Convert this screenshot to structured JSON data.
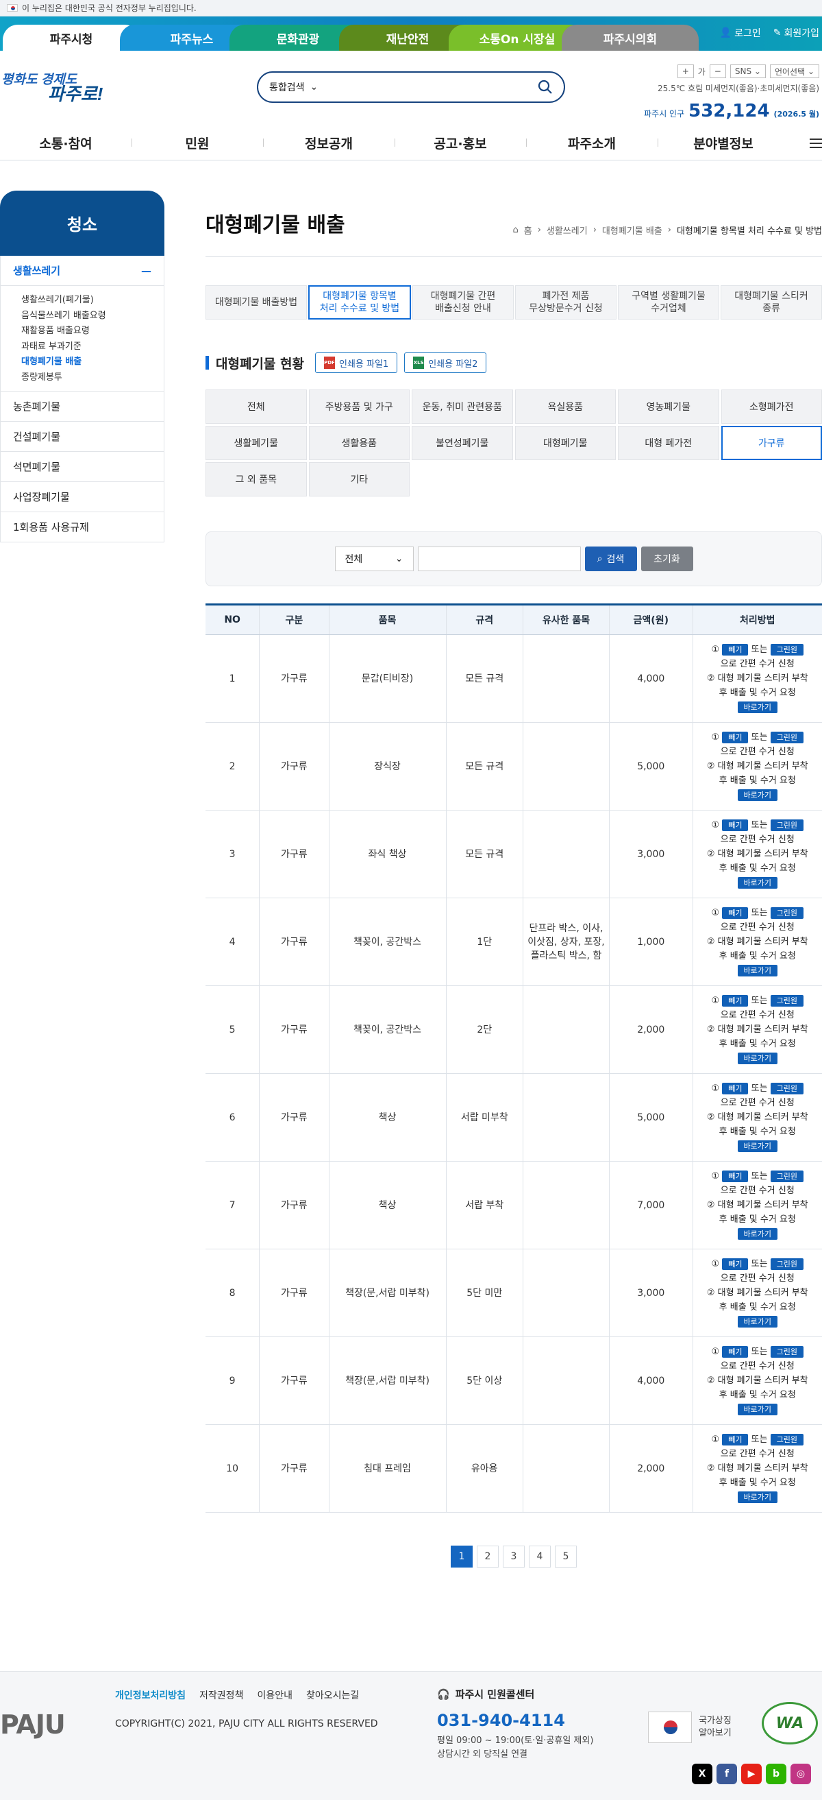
{
  "gov_notice": "이 누리집은 대한민국 공식 전자정부 누리집입니다.",
  "top_tabs": [
    {
      "label": "파주시청",
      "color": "#ffffff",
      "active": true
    },
    {
      "label": "파주뉴스",
      "color": "#1996d8"
    },
    {
      "label": "문화관광",
      "color": "#13a37f"
    },
    {
      "label": "재난안전",
      "color": "#5c8a1c"
    },
    {
      "label": "소통On 시장실",
      "color": "#7abf2a"
    },
    {
      "label": "파주시의회",
      "color": "#8a8a8a"
    }
  ],
  "util": {
    "login": "로그인",
    "join": "회원가입"
  },
  "logo": {
    "line1": "평화도 경제도",
    "line2": "파주로!"
  },
  "search": {
    "scope": "통합검색",
    "placeholder": ""
  },
  "tools": {
    "font_plus": "+",
    "font_label": "가",
    "font_minus": "−",
    "sns": "SNS",
    "lang": "언어선택"
  },
  "weather": "25.5℃ 흐림 미세먼지(좋음)·초미세먼지(좋음)",
  "population": {
    "label": "파주시 인구",
    "value": "532,124",
    "date": "(2026.5 월)"
  },
  "gnb": [
    "소통·참여",
    "민원",
    "정보공개",
    "공고·홍보",
    "파주소개",
    "분야별정보"
  ],
  "lnb": {
    "title": "청소",
    "section_open": "생활쓰레기",
    "sub": [
      "생활쓰레기(폐기물)",
      "음식물쓰레기 배출요령",
      "재활용품 배출요령",
      "과태료 부과기준",
      "대형폐기물 배출",
      "종량제봉투"
    ],
    "sub_active": 4,
    "sections": [
      "농촌폐기물",
      "건설폐기물",
      "석면폐기물",
      "사업장폐기물",
      "1회용품 사용규제"
    ]
  },
  "page_title": "대형폐기물 배출",
  "breadcrumb": [
    "홈",
    "생활쓰레기",
    "대형폐기물 배출",
    "대형폐기물 항목별 처리 수수료 및 방법"
  ],
  "sub_tabs": [
    {
      "l1": "대형폐기물 배출방법",
      "l2": ""
    },
    {
      "l1": "대형폐기물 항목별",
      "l2": "처리 수수료 및 방법",
      "active": true
    },
    {
      "l1": "대형폐기물 간편",
      "l2": "배출신청 안내"
    },
    {
      "l1": "폐가전 제품",
      "l2": "무상방문수거 신청"
    },
    {
      "l1": "구역별 생활폐기물",
      "l2": "수거업체"
    },
    {
      "l1": "대형폐기물 스티커",
      "l2": "종류"
    }
  ],
  "status_section": {
    "title": "대형폐기물 현황",
    "print1": "인쇄용 파일1",
    "print2": "인쇄용 파일2",
    "pdf_icon": "PDF",
    "xls_icon": "XLS"
  },
  "categories": [
    "전체",
    "주방용품 및 가구",
    "운동, 취미 관련용품",
    "욕실용품",
    "영농폐기물",
    "소형폐가전",
    "생활폐기물",
    "생활용품",
    "불연성폐기물",
    "대형폐기물",
    "대형 폐가전",
    "가구류",
    "그 외 품목",
    "기타"
  ],
  "category_active": 11,
  "filter": {
    "select": "전체",
    "search_btn": "검색",
    "reset_btn": "초기화"
  },
  "table": {
    "headers": [
      "NO",
      "구분",
      "품목",
      "규격",
      "유사한 품목",
      "금액(원)",
      "처리방법"
    ],
    "rows": [
      {
        "no": "1",
        "cat": "가구류",
        "item": "문갑(티비장)",
        "spec": "모든 규격",
        "similar": "",
        "price": "4,000"
      },
      {
        "no": "2",
        "cat": "가구류",
        "item": "장식장",
        "spec": "모든 규격",
        "similar": "",
        "price": "5,000"
      },
      {
        "no": "3",
        "cat": "가구류",
        "item": "좌식 책상",
        "spec": "모든 규격",
        "similar": "",
        "price": "3,000"
      },
      {
        "no": "4",
        "cat": "가구류",
        "item": "책꽂이, 공간박스",
        "spec": "1단",
        "similar": "단프라 박스, 이사, 이삿짐, 상자, 포장, 플라스틱 박스, 함",
        "price": "1,000"
      },
      {
        "no": "5",
        "cat": "가구류",
        "item": "책꽂이, 공간박스",
        "spec": "2단",
        "similar": "",
        "price": "2,000"
      },
      {
        "no": "6",
        "cat": "가구류",
        "item": "책상",
        "spec": "서랍 미부착",
        "similar": "",
        "price": "5,000"
      },
      {
        "no": "7",
        "cat": "가구류",
        "item": "책상",
        "spec": "서랍 부착",
        "similar": "",
        "price": "7,000"
      },
      {
        "no": "8",
        "cat": "가구류",
        "item": "책장(문,서랍 미부착)",
        "spec": "5단 미만",
        "similar": "",
        "price": "3,000"
      },
      {
        "no": "9",
        "cat": "가구류",
        "item": "책장(문,서랍 미부착)",
        "spec": "5단 이상",
        "similar": "",
        "price": "4,000"
      },
      {
        "no": "10",
        "cat": "가구류",
        "item": "침대 프레임",
        "spec": "유아용",
        "similar": "",
        "price": "2,000"
      }
    ]
  },
  "method": {
    "m1": "①",
    "badge1": "빼기",
    "or": "또는",
    "badge2": "그린원",
    "line1b": "으로 간편 수거 신청",
    "line2": "② 대형 폐기물 스티커 부착",
    "line3": "후 배출 및 수거 요청",
    "go": "바로가기"
  },
  "pagination": [
    "1",
    "2",
    "3",
    "4",
    "5"
  ],
  "footer": {
    "links": [
      "개인정보처리방침",
      "저작권정책",
      "이용안내",
      "찾아오시는길"
    ],
    "copyright": "COPYRIGHT(C) 2021, PAJU CITY ALL RIGHTS RESERVED",
    "logo": "PAJU",
    "cc_title": "파주시 민원콜센터",
    "cc_phone": "031-940-4114",
    "cc_hours": "평일 09:00 ~ 19:00(토·일·공휴일 제외)",
    "cc_note": "상담시간 외 당직실 연결",
    "emblem1": "국가상징",
    "emblem2": "알아보기",
    "wa": "WA",
    "sns": [
      {
        "icon": "X",
        "color": "#000000"
      },
      {
        "icon": "f",
        "color": "#3b5998"
      },
      {
        "icon": "▶",
        "color": "#e62117"
      },
      {
        "icon": "b",
        "color": "#2db400"
      },
      {
        "icon": "◎",
        "color": "#c13584"
      }
    ]
  }
}
